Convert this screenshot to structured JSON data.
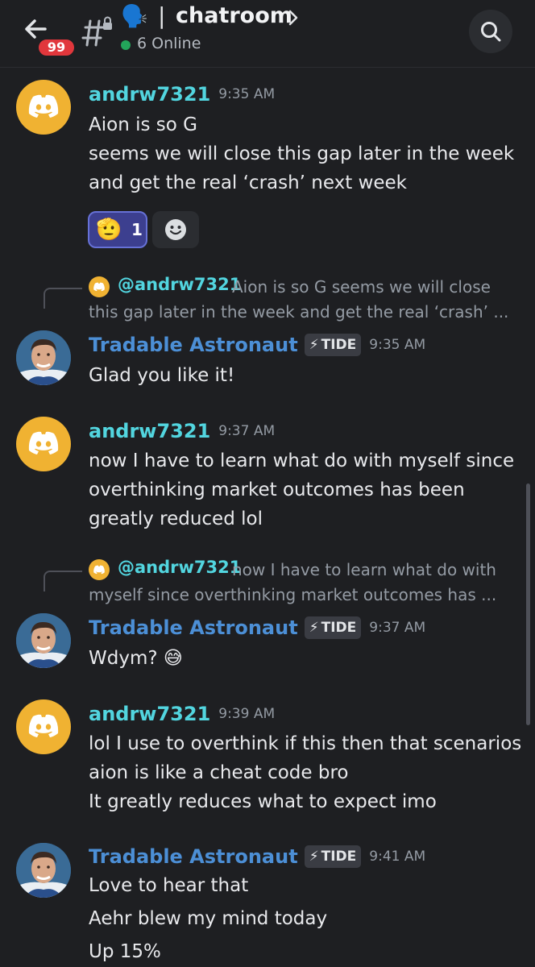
{
  "header": {
    "back_label": "back",
    "unread_badge": "99",
    "channel_emoji": "🗣️",
    "separator": "|",
    "channel_name": "chatroom",
    "online_text": "6 Online"
  },
  "messages": [
    {
      "username": "andrw7321",
      "time": "9:35 AM",
      "lines": [
        "Aion is so G",
        "seems we will close this gap later in the week",
        "and get the real ‘crash’ next week"
      ],
      "reaction": {
        "emoji": "🫡",
        "count": "1"
      }
    },
    {
      "reply": {
        "mention": "@andrw7321",
        "text_line1": "Aion is so G seems we will close",
        "text_line2": "this gap later in the week and get the real ‘crash’ ..."
      },
      "username": "Tradable Astronaut",
      "tag": "TIDE",
      "tag_icon": "⚡",
      "time": "9:35 AM",
      "lines": [
        "Glad you like it!"
      ]
    },
    {
      "username": "andrw7321",
      "time": "9:37 AM",
      "lines": [
        "now I have to learn what do with myself since",
        "overthinking market outcomes has been",
        "greatly reduced lol"
      ]
    },
    {
      "reply": {
        "mention": "@andrw7321",
        "text_line1": "now I have to learn what do with",
        "text_line2": "myself since overthinking market outcomes has ..."
      },
      "username": "Tradable Astronaut",
      "tag": "TIDE",
      "tag_icon": "⚡",
      "time": "9:37 AM",
      "lines": [
        "Wdym? 😅"
      ]
    },
    {
      "username": "andrw7321",
      "time": "9:39 AM",
      "lines": [
        "lol I use to overthink if this then that scenarios",
        "aion is like a cheat code bro",
        "It greatly reduces what to expect imo"
      ]
    },
    {
      "username": "Tradable Astronaut",
      "tag": "TIDE",
      "tag_icon": "⚡",
      "time": "9:41 AM",
      "lines": [
        "Love to hear that",
        "Aehr blew my mind today",
        "Up 15%"
      ]
    }
  ]
}
